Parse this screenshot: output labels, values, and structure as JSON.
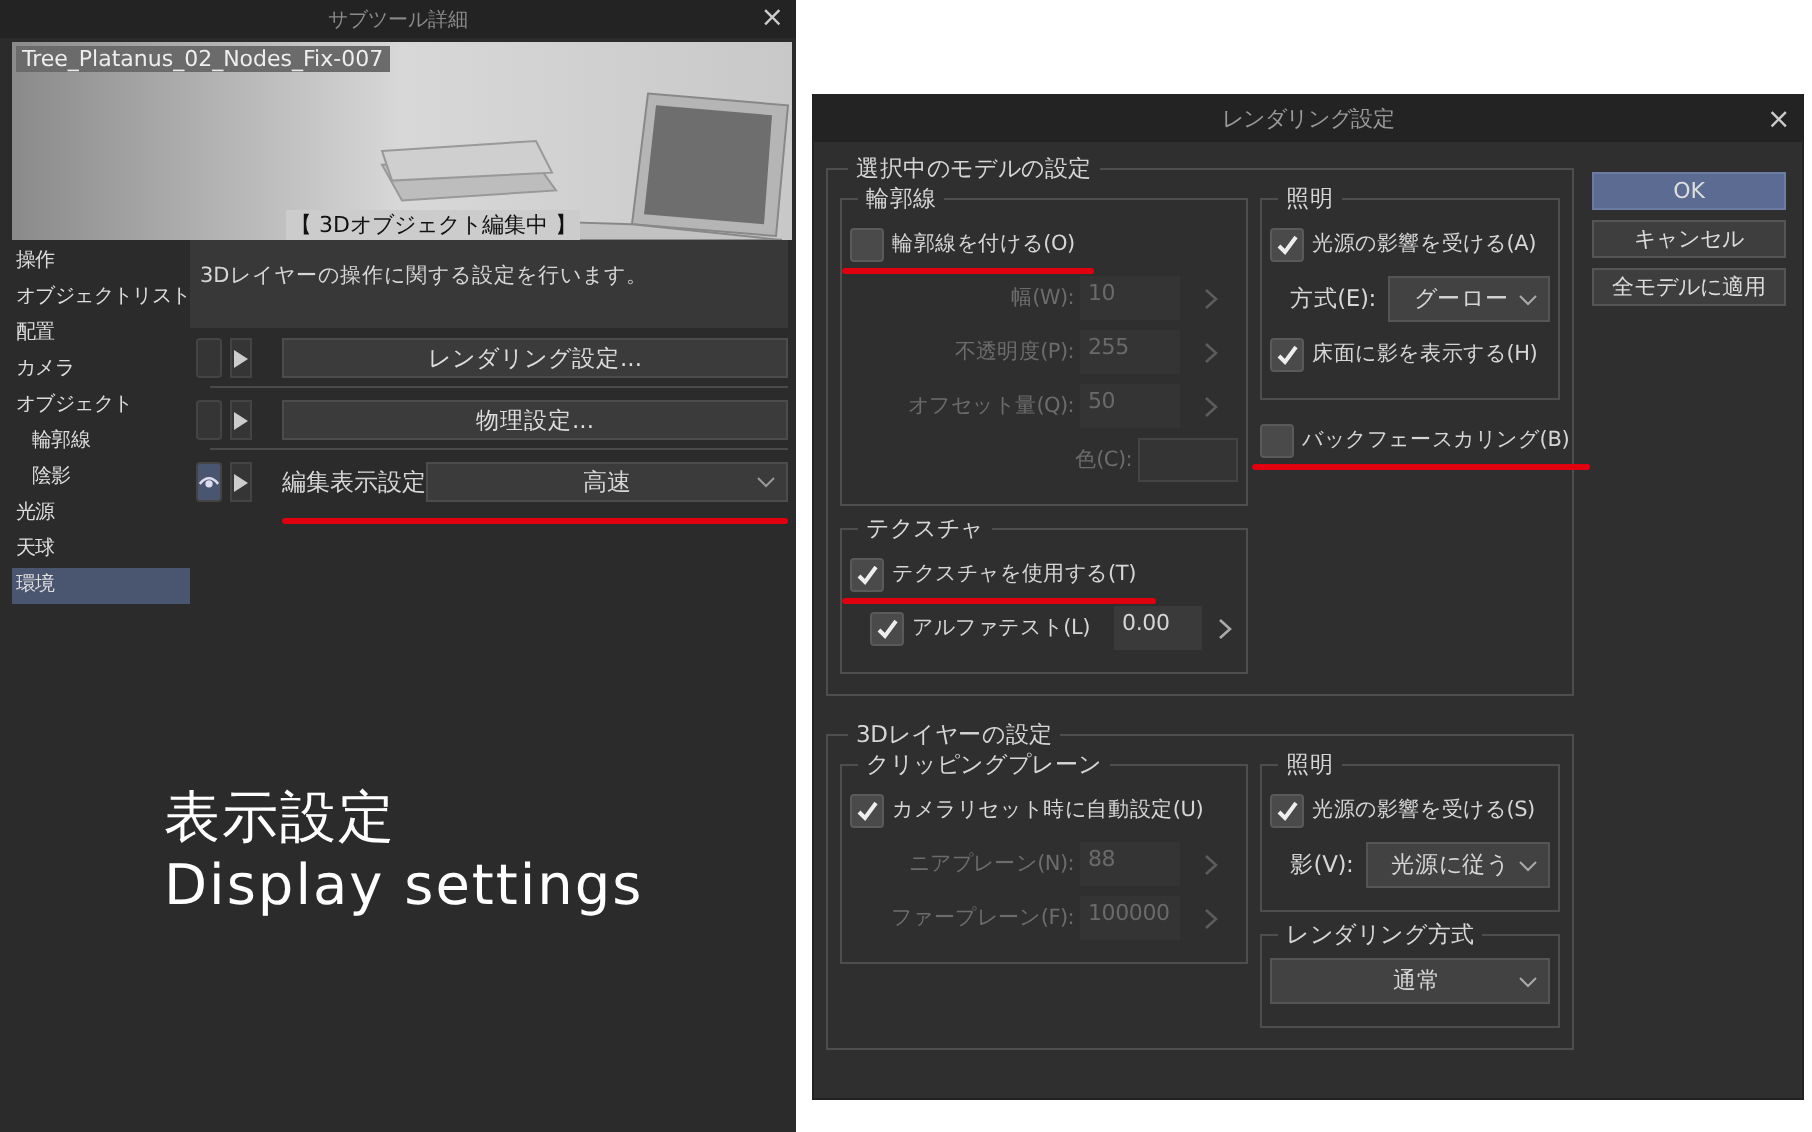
{
  "subtool_panel": {
    "title": "サブツール詳細",
    "close": "×",
    "preview": {
      "kind": "picture",
      "name": "Tree_Platanus_02_Nodes_Fix-007",
      "status": "【 3Dオブジェクト編集中 】"
    },
    "categories": [
      {
        "label": "操作",
        "selected": false
      },
      {
        "label": "オブジェクトリスト",
        "selected": false
      },
      {
        "label": "配置",
        "selected": false
      },
      {
        "label": "カメラ",
        "selected": false
      },
      {
        "label": "オブジェクト",
        "selected": false,
        "children": [
          {
            "label": "輪郭線",
            "selected": false
          },
          {
            "label": "陰影",
            "selected": false
          }
        ]
      },
      {
        "label": "光源",
        "selected": false
      },
      {
        "label": "天球",
        "selected": false
      },
      {
        "label": "環境",
        "selected": true
      }
    ],
    "description": "3Dレイヤーの操作に関する設定を行います。",
    "rows": [
      {
        "kind": "button",
        "label": "レンダリング設定...",
        "visible": false
      },
      {
        "kind": "button",
        "label": "物理設定...",
        "visible": false
      },
      {
        "kind": "select",
        "label": "編集表示設定",
        "value": "高速",
        "visible": true,
        "underlined": true
      }
    ]
  },
  "caption": [
    "表示設定",
    "Display settings"
  ],
  "dialog": {
    "title": "レンダリング設定",
    "close": "×",
    "buttons": [
      {
        "label": "OK",
        "default": true
      },
      {
        "label": "キャンセル",
        "default": false
      },
      {
        "label": "全モデルに適用",
        "default": false
      }
    ],
    "sections": [
      {
        "title": "選択中のモデルの設定",
        "columns": [
          [
            {
              "title": "輪郭線",
              "items": [
                {
                  "kind": "checkbox",
                  "label": "輪郭線を付ける(O)",
                  "checked": false,
                  "underlined": true
                },
                {
                  "kind": "spin",
                  "label": "幅(W):",
                  "value": "10",
                  "disabled": true
                },
                {
                  "kind": "spin",
                  "label": "不透明度(P):",
                  "value": "255",
                  "disabled": true
                },
                {
                  "kind": "spin",
                  "label": "オフセット量(Q):",
                  "value": "50",
                  "disabled": true
                },
                {
                  "kind": "color",
                  "label": "色(C):",
                  "disabled": true
                }
              ]
            },
            {
              "title": "テクスチャ",
              "items": [
                {
                  "kind": "checkbox",
                  "label": "テクスチャを使用する(T)",
                  "checked": true,
                  "underlined": true
                },
                {
                  "kind": "checkbox",
                  "label": "アルファテスト(L)",
                  "checked": true,
                  "value": "0.00"
                }
              ]
            }
          ],
          [
            {
              "title": "照明",
              "items": [
                {
                  "kind": "checkbox",
                  "label": "光源の影響を受ける(A)",
                  "checked": true
                },
                {
                  "kind": "select",
                  "label": "方式(E):",
                  "value": "グーロー"
                },
                {
                  "kind": "checkbox",
                  "label": "床面に影を表示する(H)",
                  "checked": true
                }
              ]
            },
            {
              "items": [
                {
                  "kind": "checkbox",
                  "label": "バックフェースカリング(B)",
                  "checked": false,
                  "underlined": true
                }
              ]
            }
          ]
        ]
      },
      {
        "title": "3Dレイヤーの設定",
        "columns": [
          [
            {
              "title": "クリッピングプレーン",
              "items": [
                {
                  "kind": "checkbox",
                  "label": "カメラリセット時に自動設定(U)",
                  "checked": true
                },
                {
                  "kind": "spin",
                  "label": "ニアプレーン(N):",
                  "value": "88",
                  "disabled": true
                },
                {
                  "kind": "spin",
                  "label": "ファープレーン(F):",
                  "value": "100000",
                  "disabled": true
                }
              ]
            }
          ],
          [
            {
              "title": "照明",
              "items": [
                {
                  "kind": "checkbox",
                  "label": "光源の影響を受ける(S)",
                  "checked": true
                },
                {
                  "kind": "select",
                  "label": "影(V):",
                  "value": "光源に従う"
                }
              ]
            },
            {
              "title": "レンダリング方式",
              "items": [
                {
                  "kind": "select",
                  "value": "通常"
                }
              ]
            }
          ]
        ]
      }
    ]
  }
}
